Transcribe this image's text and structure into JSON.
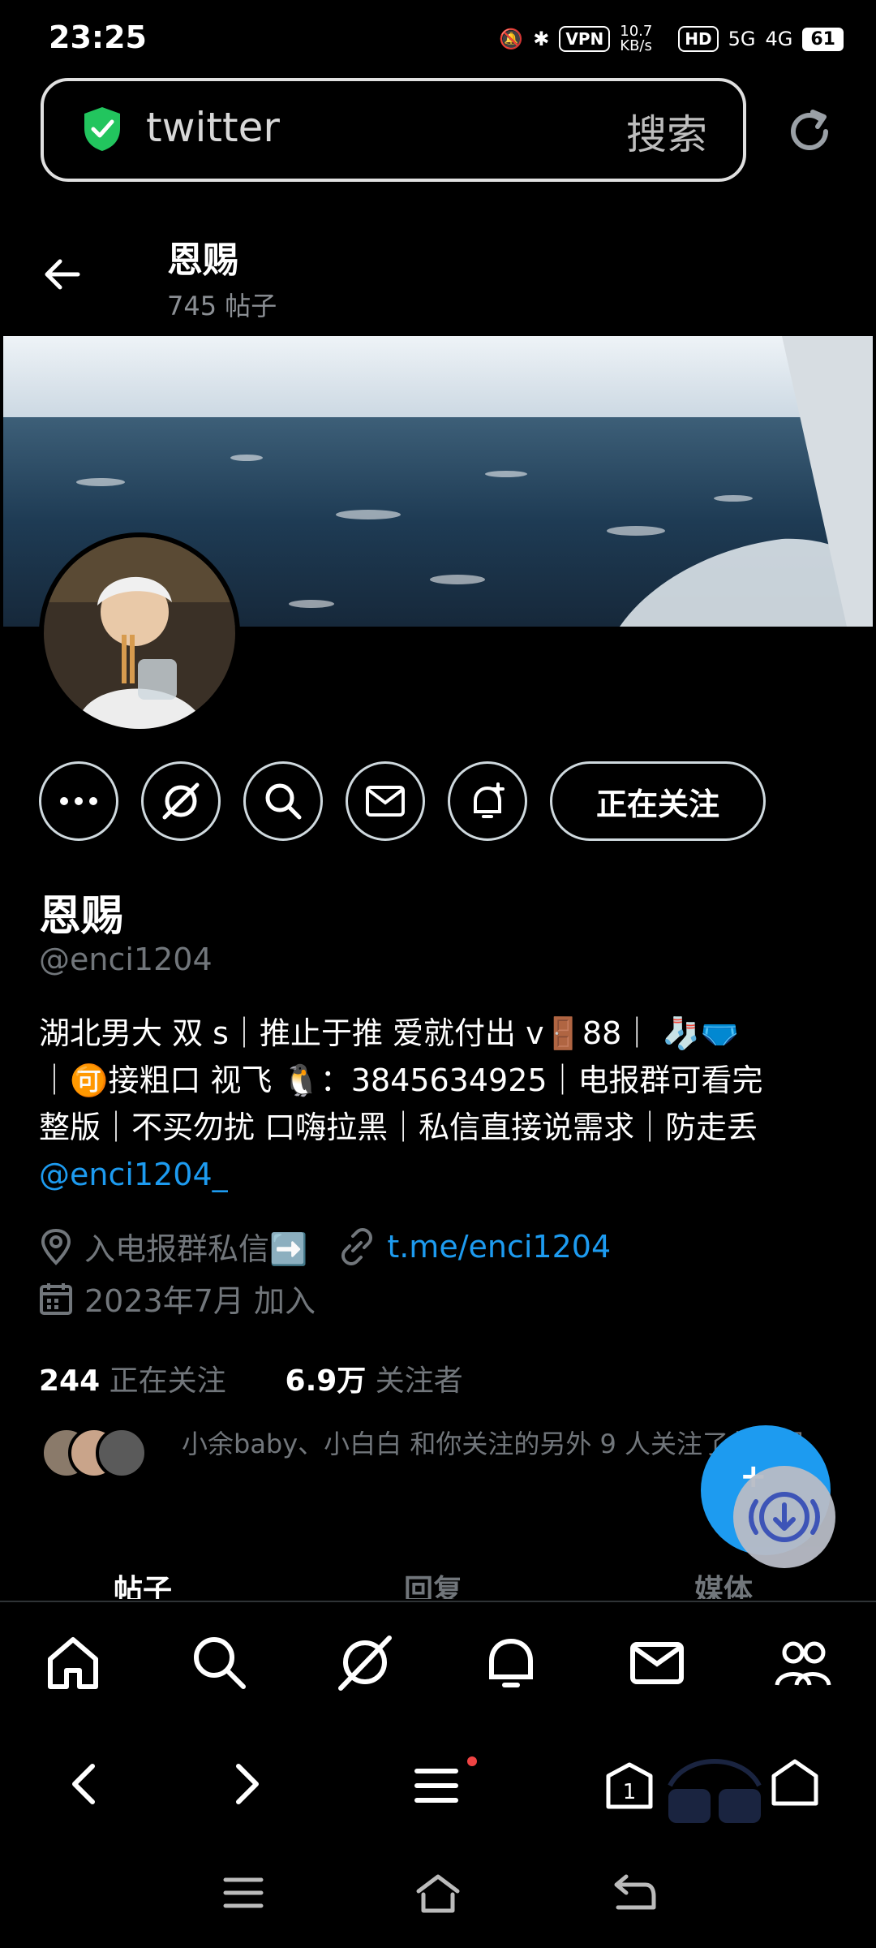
{
  "status": {
    "time": "23:25",
    "vpn": "VPN",
    "speed": "10.7 KB/s",
    "hd": "HD",
    "net1": "5G",
    "net2": "4G",
    "battery": "61"
  },
  "browser": {
    "url_text": "twitter",
    "search_label": "搜索"
  },
  "header": {
    "title": "恩赐",
    "posts": "745 帖子"
  },
  "profile": {
    "name": "恩赐",
    "handle": "@enci1204",
    "bio_line1": "湖北男大 双 s｜推止于推 爱就付出 v🚪88｜ 🧦🩲",
    "bio_line2": "｜🉑接粗口 视飞 🐧：3845634925｜电报群可看完",
    "bio_line3": "整版｜不买勿扰 口嗨拉黑｜私信直接说需求｜防走丢",
    "bio_link": "@enci1204_",
    "location": "入电报群私信➡️",
    "website": "t.me/enci1204",
    "joined": "2023年7月 加入",
    "following_count": "244",
    "following_label": "正在关注",
    "followers_count": "6.9万",
    "followers_label": "关注者",
    "mutual_text": "小余baby、小白白 和你关注的另外 9 人关注了此账号",
    "follow_button": "正在关注"
  },
  "tabs": [
    "帖子",
    "回复",
    "媒体"
  ],
  "colors": {
    "accent": "#1d9bf0",
    "muted": "#71767b",
    "bg": "#000000"
  }
}
